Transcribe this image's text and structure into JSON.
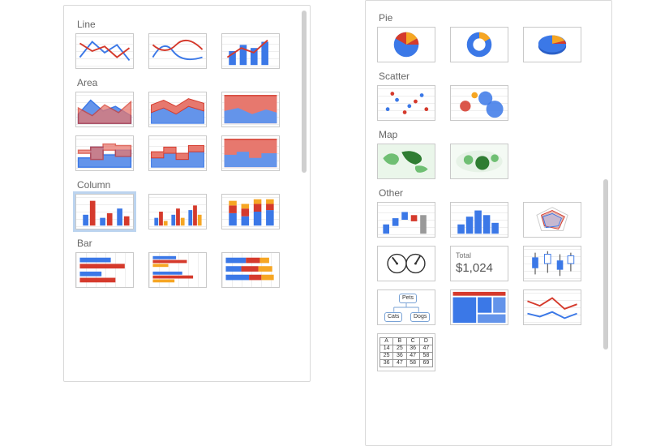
{
  "meta": {
    "description": "Google Sheets chart-type picker thumbnails, two column panels",
    "colors": {
      "blue": "#3b78e7",
      "blue_fill": "#6494ea",
      "red": "#d53a2c",
      "red_fill": "#e7786e",
      "orange": "#f6a623",
      "green_dark": "#2f7d32",
      "green_light": "#6fbf73",
      "grid": "#eeeeee",
      "border": "#c9c9c9"
    }
  },
  "left": {
    "sections": {
      "line": "Line",
      "area": "Area",
      "column": "Column",
      "bar": "Bar"
    }
  },
  "right": {
    "sections": {
      "pie": "Pie",
      "scatter": "Scatter",
      "map": "Map",
      "other": "Other"
    }
  },
  "thumbs": {
    "org": {
      "top": "Pets",
      "left": "Cats",
      "right": "Dogs"
    },
    "scorecard": {
      "label": "Total",
      "value": "$1,024"
    },
    "table": {
      "header": [
        "A",
        "B",
        "C",
        "D"
      ],
      "rows": [
        [
          "14",
          "25",
          "36",
          "47"
        ],
        [
          "25",
          "36",
          "47",
          "58"
        ],
        [
          "36",
          "47",
          "58",
          "69"
        ]
      ]
    },
    "names": {
      "line_basic": "Line chart",
      "line_smooth": "Smooth line chart",
      "line_combo": "Combo chart",
      "area_basic": "Area chart",
      "area_stacked": "Stacked area chart",
      "area_full": "100% stacked area chart",
      "area_step": "Stepped area chart",
      "area_step_stacked": "Stacked stepped area chart",
      "area_step_full": "100% stacked stepped area chart",
      "column_basic": "Column chart",
      "column_grouped": "Grouped column chart",
      "column_stacked": "Stacked column chart",
      "bar_basic": "Bar chart",
      "bar_grouped": "Grouped bar chart",
      "bar_stacked": "Stacked bar chart",
      "pie_basic": "Pie chart",
      "pie_donut": "Donut chart",
      "pie_3d": "3D pie chart",
      "scatter_basic": "Scatter chart",
      "scatter_bubble": "Bubble chart",
      "map_geo": "Geo chart",
      "map_markers": "Geo chart with markers",
      "other_waterfall": "Waterfall chart",
      "other_histogram": "Histogram chart",
      "other_radar": "Radar chart",
      "other_gauge": "Gauge chart",
      "other_scorecard": "Scorecard chart",
      "other_candlestick": "Candlestick chart",
      "other_org": "Organizational chart",
      "other_treemap": "Tree map chart",
      "other_timeline": "Timeline chart",
      "other_table": "Table chart"
    }
  }
}
